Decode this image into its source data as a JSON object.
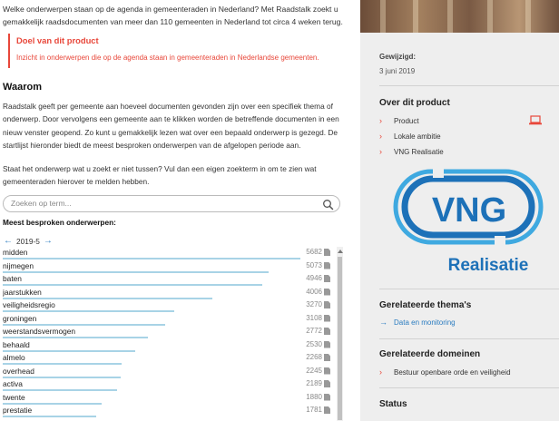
{
  "intro": {
    "text": "Welke onderwerpen staan op de agenda in gemeenteraden in Nederland? Met Raadstalk zoekt u gemakkelijk raadsdocumenten van meer dan 110 gemeenten in Nederland tot circa 4 weken terug."
  },
  "purpose": {
    "title": "Doel van dit product",
    "text": "Inzicht in onderwerpen die op de agenda staan in gemeenteraden in Nederlandse gemeenten."
  },
  "why": {
    "heading": "Waarom",
    "para1": "Raadstalk geeft per gemeente aan hoeveel documenten gevonden zijn over een specifiek thema of onderwerp. Door vervolgens een gemeente aan te klikken worden de betreffende documenten in een nieuw venster geopend. Zo kunt u gemakkelijk lezen wat over een bepaald onderwerp is gezegd. De startlijst hieronder biedt de meest besproken onderwerpen van de afgelopen periode aan.",
    "para2": "Staat het onderwerp wat u zoekt er niet tussen? Vul dan een eigen zoekterm in om te zien wat gemeenteraden hierover te melden hebben."
  },
  "search": {
    "placeholder": "Zoeken op term..."
  },
  "topics": {
    "title": "Meest besproken onderwerpen:",
    "period": "2019-5",
    "max": 5682,
    "items": [
      {
        "name": "midden",
        "count": 5682
      },
      {
        "name": "nijmegen",
        "count": 5073
      },
      {
        "name": "baten",
        "count": 4946
      },
      {
        "name": "jaarstukken",
        "count": 4006
      },
      {
        "name": "veiligheidsregio",
        "count": 3270
      },
      {
        "name": "groningen",
        "count": 3108
      },
      {
        "name": "weerstandsvermogen",
        "count": 2772
      },
      {
        "name": "behaald",
        "count": 2530
      },
      {
        "name": "almelo",
        "count": 2268
      },
      {
        "name": "overhead",
        "count": 2245
      },
      {
        "name": "activa",
        "count": 2189
      },
      {
        "name": "twente",
        "count": 1880
      },
      {
        "name": "prestatie",
        "count": 1781
      }
    ]
  },
  "sidebar": {
    "modified_label": "Gewijzigd:",
    "modified_date": "3 juni 2019",
    "about_heading": "Over dit product",
    "about_links": [
      "Product",
      "Lokale ambitie",
      "VNG Realisatie"
    ],
    "logo": {
      "text": "VNG",
      "subtext": "Realisatie"
    },
    "themes_heading": "Gerelateerde thema's",
    "themes_links": [
      "Data en monitoring"
    ],
    "domains_heading": "Gerelateerde domeinen",
    "domains_links": [
      "Bestuur openbare orde en veiligheid"
    ],
    "status_heading": "Status"
  },
  "colors": {
    "accent_red": "#e8473a",
    "link_blue": "#2a7cc0",
    "bar": "#a8d3e6",
    "logo_blue": "#1d71b8",
    "logo_lightblue": "#3fa9e0"
  }
}
